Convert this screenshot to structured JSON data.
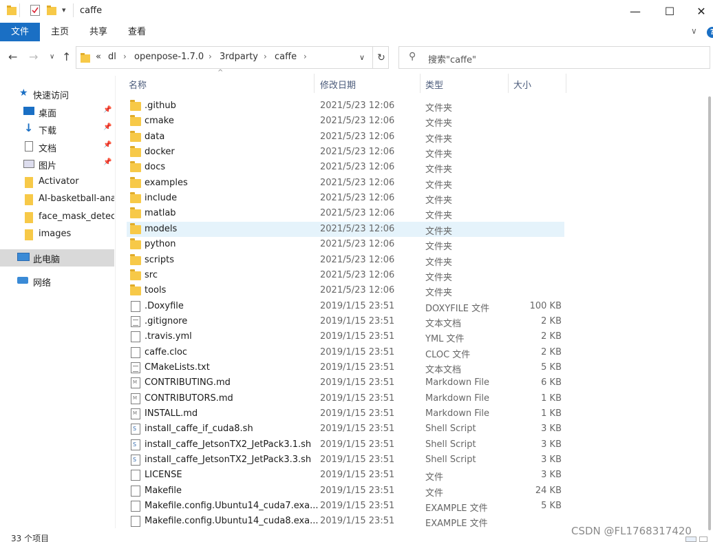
{
  "window": {
    "title": "caffe",
    "minimize_icon": "minimize-icon",
    "maximize_icon": "maximize-icon",
    "close_icon": "close-icon"
  },
  "ribbon": {
    "tabs": [
      "文件",
      "主页",
      "共享",
      "查看"
    ],
    "help": "?"
  },
  "address": {
    "prefix": "«",
    "segments": [
      "dl",
      "openpose-1.7.0",
      "3rdparty",
      "caffe"
    ]
  },
  "search": {
    "placeholder": "搜索\"caffe\""
  },
  "sidebar": {
    "items": [
      {
        "label": "快速访问",
        "icon": "star-icon"
      },
      {
        "label": "桌面",
        "icon": "desktop-icon",
        "pinned": true
      },
      {
        "label": "下载",
        "icon": "download-icon",
        "pinned": true
      },
      {
        "label": "文档",
        "icon": "document-icon",
        "pinned": true
      },
      {
        "label": "图片",
        "icon": "picture-icon",
        "pinned": true
      },
      {
        "label": "Activator",
        "icon": "folder-icon"
      },
      {
        "label": "AI-basketball-ana",
        "icon": "folder-icon"
      },
      {
        "label": "face_mask_detecti",
        "icon": "folder-icon"
      },
      {
        "label": "images",
        "icon": "folder-icon"
      },
      {
        "label": "此电脑",
        "icon": "computer-icon"
      },
      {
        "label": "网络",
        "icon": "network-icon"
      }
    ]
  },
  "columns": {
    "name": "名称",
    "date": "修改日期",
    "type": "类型",
    "size": "大小"
  },
  "files": [
    {
      "name": ".github",
      "date": "2021/5/23 12:06",
      "type": "文件夹",
      "size": "",
      "icon": "folder"
    },
    {
      "name": "cmake",
      "date": "2021/5/23 12:06",
      "type": "文件夹",
      "size": "",
      "icon": "folder"
    },
    {
      "name": "data",
      "date": "2021/5/23 12:06",
      "type": "文件夹",
      "size": "",
      "icon": "folder"
    },
    {
      "name": "docker",
      "date": "2021/5/23 12:06",
      "type": "文件夹",
      "size": "",
      "icon": "folder"
    },
    {
      "name": "docs",
      "date": "2021/5/23 12:06",
      "type": "文件夹",
      "size": "",
      "icon": "folder"
    },
    {
      "name": "examples",
      "date": "2021/5/23 12:06",
      "type": "文件夹",
      "size": "",
      "icon": "folder"
    },
    {
      "name": "include",
      "date": "2021/5/23 12:06",
      "type": "文件夹",
      "size": "",
      "icon": "folder"
    },
    {
      "name": "matlab",
      "date": "2021/5/23 12:06",
      "type": "文件夹",
      "size": "",
      "icon": "folder"
    },
    {
      "name": "models",
      "date": "2021/5/23 12:06",
      "type": "文件夹",
      "size": "",
      "icon": "folder",
      "hover": true
    },
    {
      "name": "python",
      "date": "2021/5/23 12:06",
      "type": "文件夹",
      "size": "",
      "icon": "folder"
    },
    {
      "name": "scripts",
      "date": "2021/5/23 12:06",
      "type": "文件夹",
      "size": "",
      "icon": "folder"
    },
    {
      "name": "src",
      "date": "2021/5/23 12:06",
      "type": "文件夹",
      "size": "",
      "icon": "folder"
    },
    {
      "name": "tools",
      "date": "2021/5/23 12:06",
      "type": "文件夹",
      "size": "",
      "icon": "folder"
    },
    {
      "name": ".Doxyfile",
      "date": "2019/1/15 23:51",
      "type": "DOXYFILE 文件",
      "size": "100 KB",
      "icon": "doc"
    },
    {
      "name": ".gitignore",
      "date": "2019/1/15 23:51",
      "type": "文本文档",
      "size": "2 KB",
      "icon": "lines"
    },
    {
      "name": ".travis.yml",
      "date": "2019/1/15 23:51",
      "type": "YML 文件",
      "size": "2 KB",
      "icon": "doc"
    },
    {
      "name": "caffe.cloc",
      "date": "2019/1/15 23:51",
      "type": "CLOC 文件",
      "size": "2 KB",
      "icon": "doc"
    },
    {
      "name": "CMakeLists.txt",
      "date": "2019/1/15 23:51",
      "type": "文本文档",
      "size": "5 KB",
      "icon": "lines"
    },
    {
      "name": "CONTRIBUTING.md",
      "date": "2019/1/15 23:51",
      "type": "Markdown File",
      "size": "6 KB",
      "icon": "md"
    },
    {
      "name": "CONTRIBUTORS.md",
      "date": "2019/1/15 23:51",
      "type": "Markdown File",
      "size": "1 KB",
      "icon": "md"
    },
    {
      "name": "INSTALL.md",
      "date": "2019/1/15 23:51",
      "type": "Markdown File",
      "size": "1 KB",
      "icon": "md"
    },
    {
      "name": "install_caffe_if_cuda8.sh",
      "date": "2019/1/15 23:51",
      "type": "Shell Script",
      "size": "3 KB",
      "icon": "sh"
    },
    {
      "name": "install_caffe_JetsonTX2_JetPack3.1.sh",
      "date": "2019/1/15 23:51",
      "type": "Shell Script",
      "size": "3 KB",
      "icon": "sh"
    },
    {
      "name": "install_caffe_JetsonTX2_JetPack3.3.sh",
      "date": "2019/1/15 23:51",
      "type": "Shell Script",
      "size": "3 KB",
      "icon": "sh"
    },
    {
      "name": "LICENSE",
      "date": "2019/1/15 23:51",
      "type": "文件",
      "size": "3 KB",
      "icon": "doc"
    },
    {
      "name": "Makefile",
      "date": "2019/1/15 23:51",
      "type": "文件",
      "size": "24 KB",
      "icon": "doc"
    },
    {
      "name": "Makefile.config.Ubuntu14_cuda7.exa...",
      "date": "2019/1/15 23:51",
      "type": "EXAMPLE 文件",
      "size": "5 KB",
      "icon": "doc"
    },
    {
      "name": "Makefile.config.Ubuntu14_cuda8.exa...",
      "date": "2019/1/15 23:51",
      "type": "EXAMPLE 文件",
      "size": "",
      "icon": "doc"
    }
  ],
  "status": {
    "count": "33 个项目"
  },
  "watermark": "CSDN @FL1768317420"
}
